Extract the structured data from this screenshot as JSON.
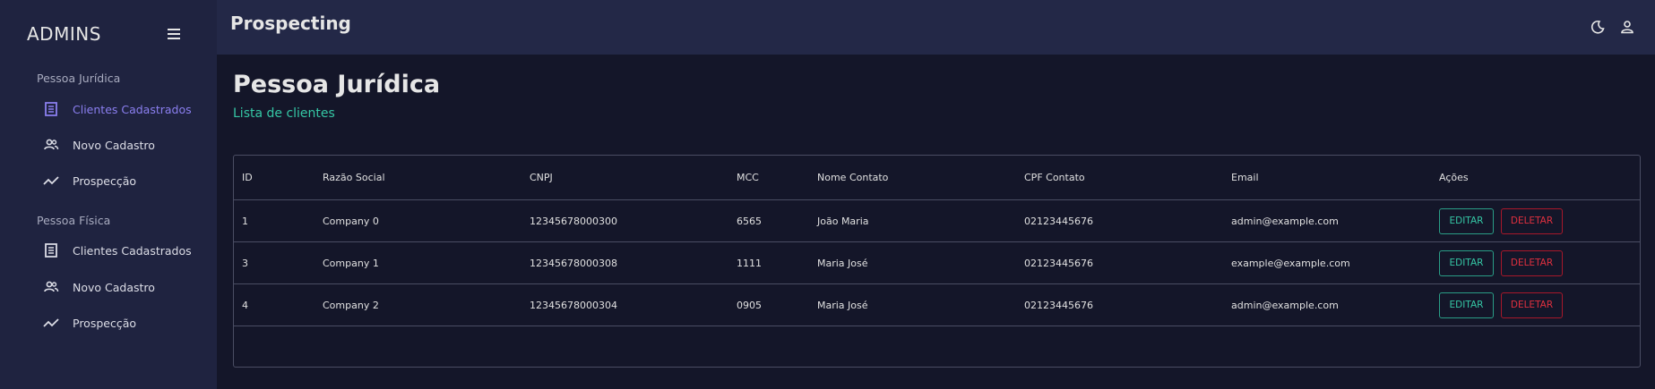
{
  "sidebar": {
    "brand": "ADMINS",
    "sections": [
      {
        "title": "Pessoa Jurídica",
        "items": [
          {
            "label": "Clientes Cadastrados",
            "icon": "list-icon",
            "active": true
          },
          {
            "label": "Novo Cadastro",
            "icon": "users-icon",
            "active": false
          },
          {
            "label": "Prospecção",
            "icon": "trend-icon",
            "active": false
          }
        ]
      },
      {
        "title": "Pessoa Física",
        "items": [
          {
            "label": "Clientes Cadastrados",
            "icon": "list-icon",
            "active": false
          },
          {
            "label": "Novo Cadastro",
            "icon": "users-icon",
            "active": false
          },
          {
            "label": "Prospecção",
            "icon": "trend-icon",
            "active": false
          }
        ]
      }
    ]
  },
  "topbar": {
    "title": "Prospecting",
    "icons": [
      "moon-icon",
      "user-icon"
    ]
  },
  "main": {
    "title": "Pessoa Jurídica",
    "subtitle": "Lista de clientes"
  },
  "table": {
    "columns": [
      "ID",
      "Razão Social",
      "CNPJ",
      "MCC",
      "Nome Contato",
      "CPF Contato",
      "Email",
      "Ações"
    ],
    "rows": [
      {
        "id": "1",
        "razao": "Company 0",
        "cnpj": "12345678000300",
        "mcc": "6565",
        "nome": "João Maria",
        "cpf": "02123445676",
        "email": "admin@example.com"
      },
      {
        "id": "3",
        "razao": "Company 1",
        "cnpj": "12345678000308",
        "mcc": "1111",
        "nome": "Maria José",
        "cpf": "02123445676",
        "email": "example@example.com"
      },
      {
        "id": "4",
        "razao": "Company 2",
        "cnpj": "12345678000304",
        "mcc": "0905",
        "nome": "Maria José",
        "cpf": "02123445676",
        "email": "admin@example.com"
      }
    ],
    "actions": {
      "edit": "EDITAR",
      "delete": "DELETAR"
    }
  },
  "colors": {
    "accent": "#8b7ff0",
    "teal": "#35c7a5",
    "danger": "#e0303f",
    "sidebar_bg": "#1f2340",
    "topbar_bg": "#232847",
    "page_bg": "#141629"
  }
}
